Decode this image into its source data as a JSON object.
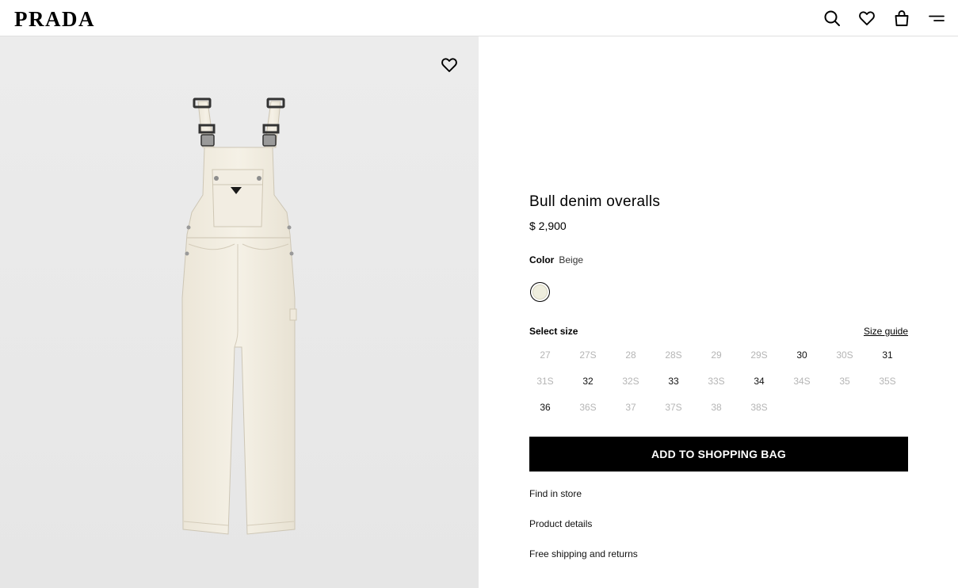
{
  "header": {
    "logo": "PRADA",
    "icons": [
      "search-icon",
      "heart-icon",
      "bag-icon",
      "menu-icon"
    ]
  },
  "gallery": {
    "wishlist_icon": "heart-icon",
    "image_description_icon": "overalls-image"
  },
  "product": {
    "title": "Bull denim overalls",
    "price": "$ 2,900",
    "color_label": "Color",
    "color_value": "Beige",
    "swatch_color": "#efeede",
    "size_label": "Select size",
    "size_guide": "Size guide",
    "sizes": [
      {
        "label": "27",
        "available": false
      },
      {
        "label": "27S",
        "available": false
      },
      {
        "label": "28",
        "available": false
      },
      {
        "label": "28S",
        "available": false
      },
      {
        "label": "29",
        "available": false
      },
      {
        "label": "29S",
        "available": false
      },
      {
        "label": "30",
        "available": true
      },
      {
        "label": "30S",
        "available": false
      },
      {
        "label": "31",
        "available": true
      },
      {
        "label": "31S",
        "available": false
      },
      {
        "label": "32",
        "available": true
      },
      {
        "label": "32S",
        "available": false
      },
      {
        "label": "33",
        "available": true
      },
      {
        "label": "33S",
        "available": false
      },
      {
        "label": "34",
        "available": true
      },
      {
        "label": "34S",
        "available": false
      },
      {
        "label": "35",
        "available": false
      },
      {
        "label": "35S",
        "available": false
      },
      {
        "label": "36",
        "available": true
      },
      {
        "label": "36S",
        "available": false
      },
      {
        "label": "37",
        "available": false
      },
      {
        "label": "37S",
        "available": false
      },
      {
        "label": "38",
        "available": false
      },
      {
        "label": "38S",
        "available": false
      }
    ],
    "add_to_bag": "ADD TO SHOPPING BAG",
    "links": {
      "find_in_store": "Find in store",
      "product_details": "Product details",
      "shipping": "Free shipping and returns"
    }
  },
  "colors": {
    "button_bg": "#000000",
    "unavailable_text": "#b5b5b5",
    "gallery_bg": "#e9e9e9",
    "fabric": "#f3efe4"
  }
}
